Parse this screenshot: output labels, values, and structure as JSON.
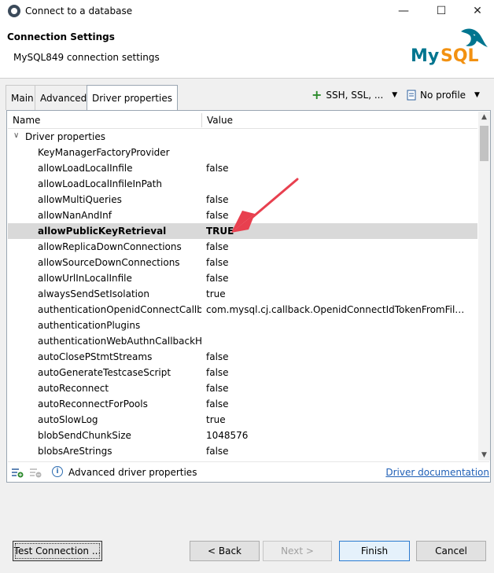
{
  "window": {
    "title": "Connect to a database",
    "controls": [
      "minimize-icon",
      "maximize-icon",
      "close-icon"
    ]
  },
  "header": {
    "title": "Connection Settings",
    "subtitle": "MySQL849 connection settings",
    "logo_text": "MySQL"
  },
  "tabs": [
    {
      "label": "Main"
    },
    {
      "label": "Advanced"
    },
    {
      "label": "Driver properties",
      "active": true
    }
  ],
  "toolbar": {
    "ssh_label": "SSH, SSL, ...",
    "profile_label": "No profile"
  },
  "grid": {
    "col_name": "Name",
    "col_value": "Value",
    "group_label": "Driver properties",
    "rows": [
      {
        "name": "KeyManagerFactoryProvider",
        "value": ""
      },
      {
        "name": "allowLoadLocalInfile",
        "value": "false"
      },
      {
        "name": "allowLoadLocalInfileInPath",
        "value": ""
      },
      {
        "name": "allowMultiQueries",
        "value": "false"
      },
      {
        "name": "allowNanAndInf",
        "value": "false"
      },
      {
        "name": "allowPublicKeyRetrieval",
        "value": "TRUE",
        "selected": true
      },
      {
        "name": "allowReplicaDownConnections",
        "value": "false"
      },
      {
        "name": "allowSourceDownConnections",
        "value": "false"
      },
      {
        "name": "allowUrlInLocalInfile",
        "value": "false"
      },
      {
        "name": "alwaysSendSetIsolation",
        "value": "true"
      },
      {
        "name": "authenticationOpenidConnectCallbac",
        "value": "com.mysql.cj.callback.OpenidConnectIdTokenFromFile..."
      },
      {
        "name": "authenticationPlugins",
        "value": ""
      },
      {
        "name": "authenticationWebAuthnCallbackHar",
        "value": ""
      },
      {
        "name": "autoClosePStmtStreams",
        "value": "false"
      },
      {
        "name": "autoGenerateTestcaseScript",
        "value": "false"
      },
      {
        "name": "autoReconnect",
        "value": "false"
      },
      {
        "name": "autoReconnectForPools",
        "value": "false"
      },
      {
        "name": "autoSlowLog",
        "value": "true"
      },
      {
        "name": "blobSendChunkSize",
        "value": "1048576"
      },
      {
        "name": "blobsAreStrings",
        "value": "false"
      },
      {
        "name": "",
        "value": "f..."
      }
    ]
  },
  "footer": {
    "advanced_label": "Advanced driver properties",
    "doc_link": "Driver documentation"
  },
  "buttons": {
    "test": "Test Connection ...",
    "back": "< Back",
    "next": "Next >",
    "finish": "Finish",
    "cancel": "Cancel"
  },
  "colors": {
    "selection": "#d9d9d9",
    "link": "#1f5fb6",
    "annotation_arrow": "#e8404f",
    "mysql_blue": "#00758f",
    "mysql_orange": "#f29111"
  }
}
